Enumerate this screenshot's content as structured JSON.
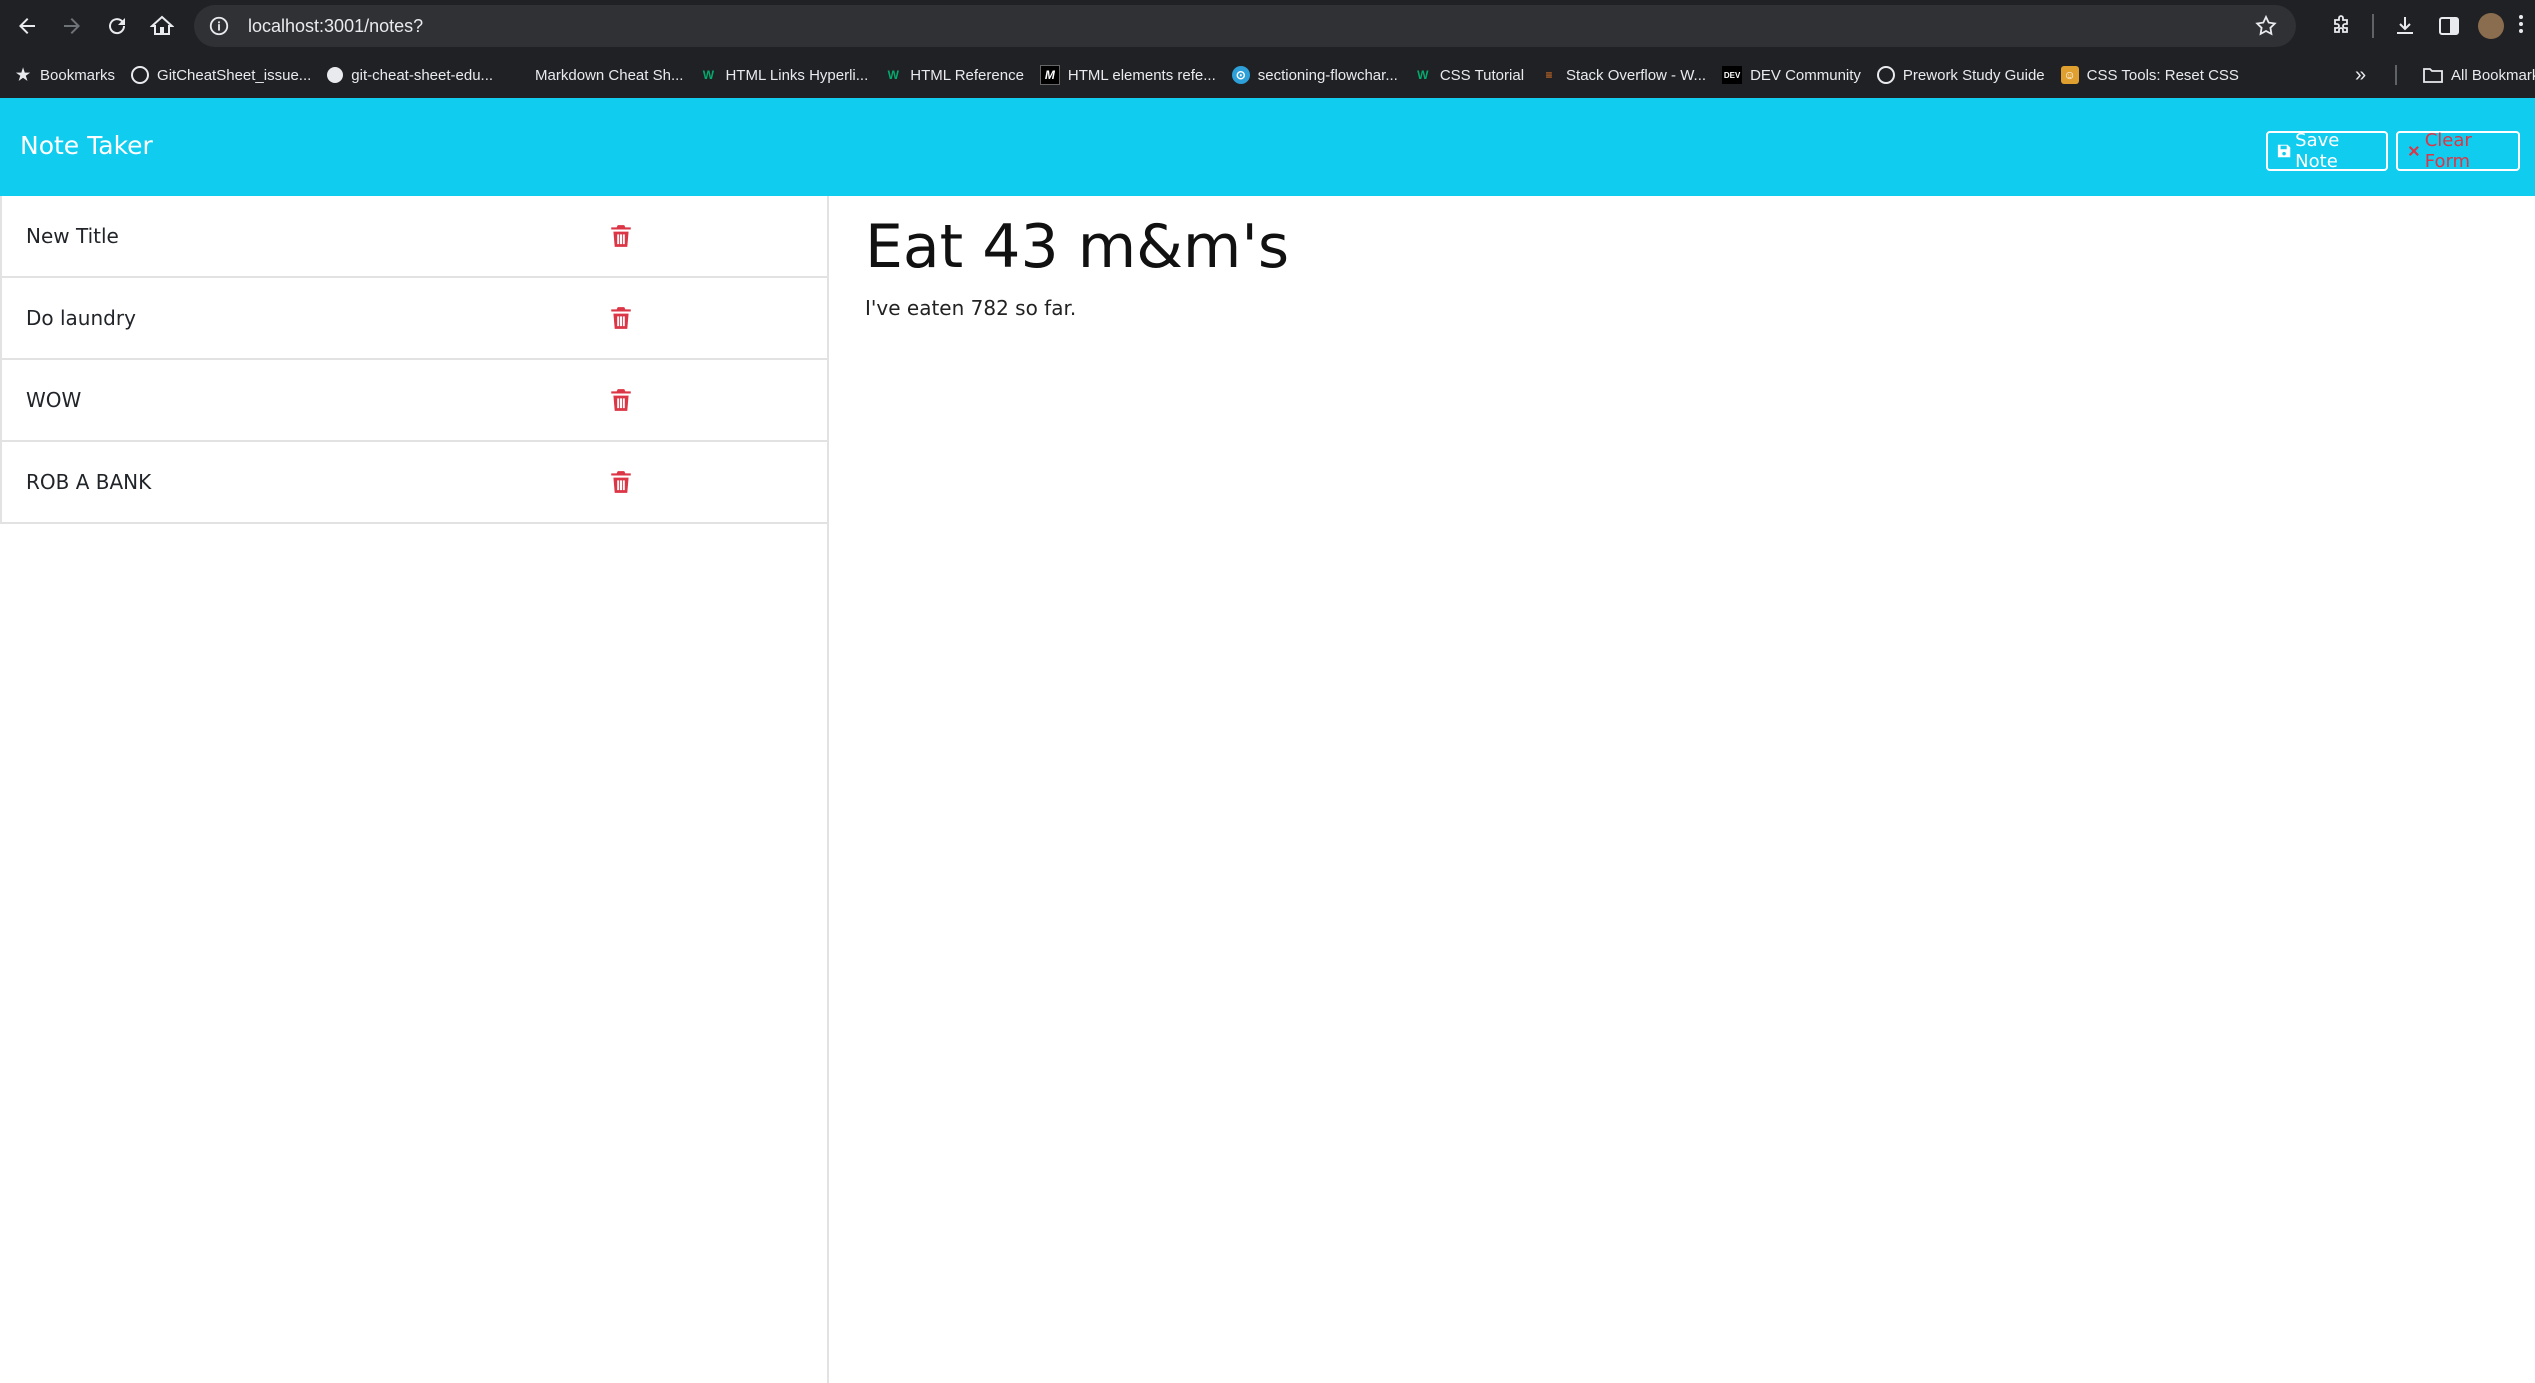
{
  "browser": {
    "url": "localhost:3001/notes?",
    "bookmarks": [
      {
        "label": "Bookmarks",
        "icon": "star-icon"
      },
      {
        "label": "GitCheatSheet_issue...",
        "icon": "globe-icon"
      },
      {
        "label": "git-cheat-sheet-edu...",
        "icon": "github-icon"
      },
      {
        "label": "Markdown Cheat Sh...",
        "icon": "blank-icon"
      },
      {
        "label": "HTML Links Hyperli...",
        "icon": "w3schools-icon"
      },
      {
        "label": "HTML Reference",
        "icon": "w3schools-icon"
      },
      {
        "label": "HTML elements refe...",
        "icon": "mdn-icon"
      },
      {
        "label": "sectioning-flowchar...",
        "icon": "drawio-icon"
      },
      {
        "label": "CSS Tutorial",
        "icon": "w3schools-icon"
      },
      {
        "label": "Stack Overflow - W...",
        "icon": "stackoverflow-icon"
      },
      {
        "label": "DEV Community",
        "icon": "dev-icon"
      },
      {
        "label": "Prework Study Guide",
        "icon": "globe-icon"
      },
      {
        "label": "CSS Tools: Reset CSS",
        "icon": "meyerweb-icon"
      }
    ],
    "more_label": "»",
    "all_bookmarks_label": "All Bookmarks"
  },
  "app": {
    "brand": "Note Taker",
    "save_label": "Save Note",
    "clear_label": "Clear Form"
  },
  "notes": [
    {
      "title": "New Title"
    },
    {
      "title": "Do laundry"
    },
    {
      "title": "WOW"
    },
    {
      "title": "ROB A BANK"
    }
  ],
  "active_note": {
    "title": "Eat 43 m&m's",
    "text": "I've eaten 782 so far."
  },
  "colors": {
    "navbar": "#10cdef",
    "danger": "#dc3545",
    "chrome": "#202124"
  }
}
